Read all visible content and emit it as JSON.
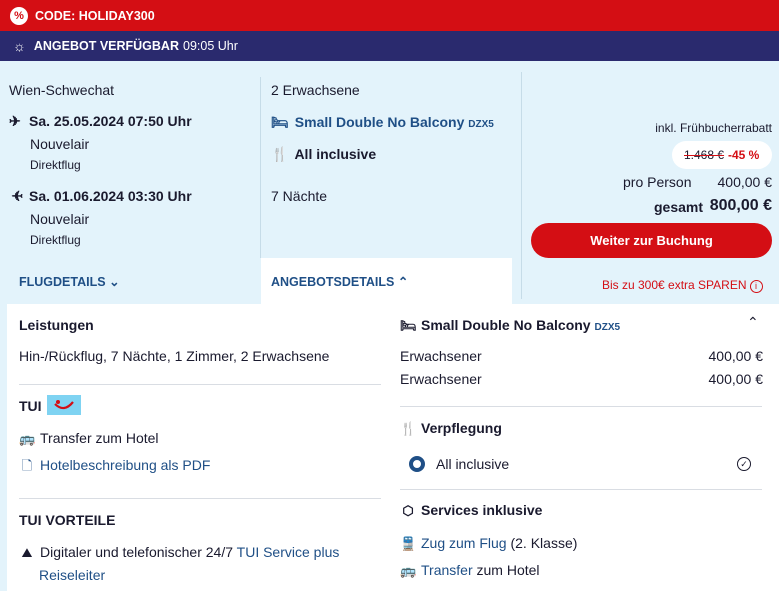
{
  "promo": {
    "icon": "percent-badge-icon",
    "label": "CODE: HOLIDAY300"
  },
  "offer": {
    "icon": "sun-icon",
    "label": "ANGEBOT VERFÜGBAR",
    "time": "09:05 Uhr"
  },
  "flights": {
    "departure_airport": "Wien-Schwechat",
    "outbound": {
      "date": "Sa. 25.05.2024 07:50 Uhr",
      "airline": "Nouvelair",
      "type": "Direktflug"
    },
    "return": {
      "date": "Sa. 01.06.2024 03:30 Uhr",
      "airline": "Nouvelair",
      "type": "Direktflug"
    },
    "details_label": "FLUGDETAILS"
  },
  "offer_summary": {
    "travellers": "2 Erwachsene",
    "room": "Small Double No Balcony",
    "room_code": "DZX5",
    "board": "All inclusive",
    "nights": "7 Nächte",
    "details_label": "ANGEBOTSDETAILS"
  },
  "price": {
    "discount_note": "inkl. Frühbucherrabatt",
    "old_price": "1.468 €",
    "discount": "-45 %",
    "per_person_label": "pro Person",
    "per_person_value": "400,00 €",
    "total_label": "gesamt",
    "total_value": "800,00 €",
    "book_button": "Weiter zur Buchung",
    "save_note": "Bis zu 300€ extra SPAREN"
  },
  "services": {
    "title": "Leistungen",
    "summary": "Hin-/Rückflug, 7 Nächte, 1 Zimmer, 2 Erwachsene",
    "tui_label": "TUI",
    "transfer": "Transfer zum Hotel",
    "hotel_pdf": "Hotelbeschreibung als PDF",
    "advantages_title": "TUI VORTEILE",
    "advantage_text": "Digitaler und telefonischer 24/7",
    "advantage_link": "TUI Service plus",
    "advantage_link2": "Reiseleiter"
  },
  "room_detail": {
    "title": "Small Double No Balcony",
    "code": "DZX5",
    "rows": [
      {
        "label": "Erwachsener",
        "value": "400,00 €"
      },
      {
        "label": "Erwachsener",
        "value": "400,00 €"
      }
    ],
    "board_title": "Verpflegung",
    "board_option": "All inclusive",
    "services_title": "Services inklusive",
    "rail_link": "Zug zum Flug",
    "rail_suffix": "(2. Klasse)",
    "transfer_link": "Transfer",
    "transfer_suffix": "zum Hotel"
  },
  "colors": {
    "brand_red": "#d40e14",
    "navy": "#2a2a6e",
    "light_blue": "#e3f3fb",
    "link": "#1f4f86"
  }
}
